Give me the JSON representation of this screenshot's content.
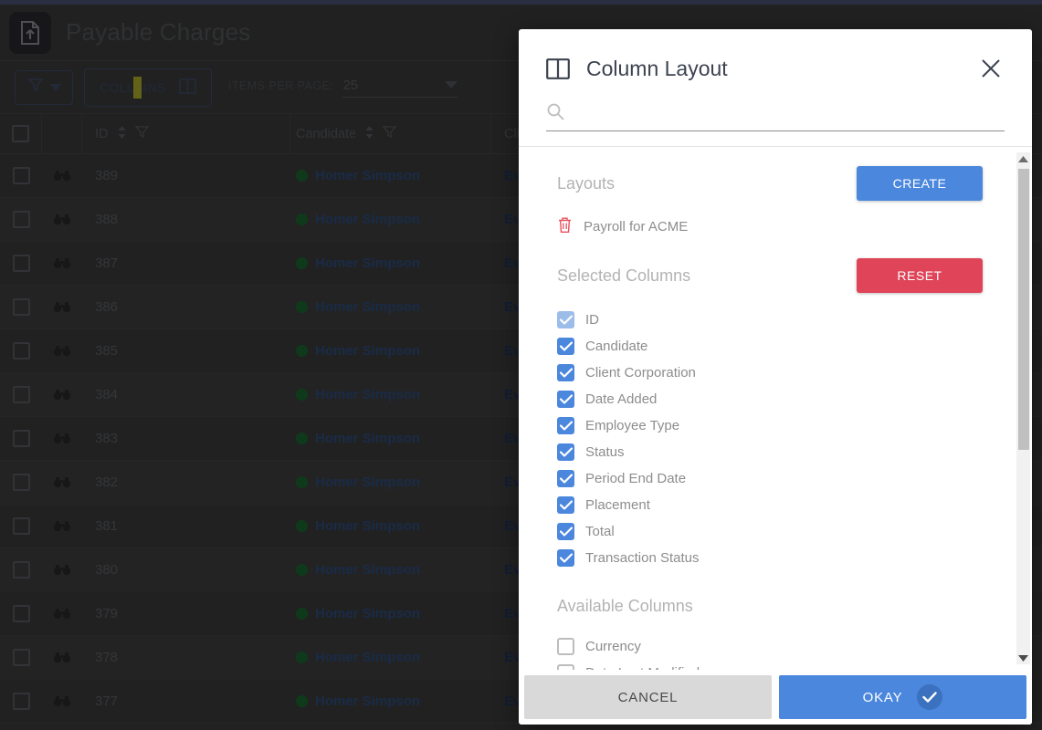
{
  "app": {
    "title": "Payable Charges",
    "logo_icon": "document-upload-icon",
    "toolbar": {
      "filter_icon": "filter-icon",
      "filter_caret_icon": "chevron-down-icon",
      "columns_label": "COLUMNS",
      "columns_icon": "column-layout-icon",
      "items_per_page_label": "ITEMS PER PAGE:",
      "items_per_page_value": "25",
      "items_per_page_arrow_icon": "chevron-down-icon"
    },
    "table": {
      "columns": [
        {
          "label": "",
          "name": "select-all"
        },
        {
          "label": "",
          "name": "preview"
        },
        {
          "label": "ID",
          "name": "id",
          "sort_icon": "sort-icon",
          "filter_icon": "filter-icon"
        },
        {
          "label": "Candidate",
          "name": "candidate",
          "sort_icon": "sort-icon",
          "filter_icon": "filter-icon"
        },
        {
          "label": "Cli",
          "name": "client-corporation"
        }
      ],
      "rows": [
        {
          "id": "389",
          "candidate": "Homer Simpson",
          "client": "Ev"
        },
        {
          "id": "388",
          "candidate": "Homer Simpson",
          "client": "Ev"
        },
        {
          "id": "387",
          "candidate": "Homer Simpson",
          "client": "Ev"
        },
        {
          "id": "386",
          "candidate": "Homer Simpson",
          "client": "Ev"
        },
        {
          "id": "385",
          "candidate": "Homer Simpson",
          "client": "Ev"
        },
        {
          "id": "384",
          "candidate": "Homer Simpson",
          "client": "Ev"
        },
        {
          "id": "383",
          "candidate": "Homer Simpson",
          "client": "Ev"
        },
        {
          "id": "382",
          "candidate": "Homer Simpson",
          "client": "Ev"
        },
        {
          "id": "381",
          "candidate": "Homer Simpson",
          "client": "Ev"
        },
        {
          "id": "380",
          "candidate": "Homer Simpson",
          "client": "Ev"
        },
        {
          "id": "379",
          "candidate": "Homer Simpson",
          "client": "Ev"
        },
        {
          "id": "378",
          "candidate": "Homer Simpson",
          "client": "Ev"
        },
        {
          "id": "377",
          "candidate": "Homer Simpson",
          "client": "Ev"
        }
      ]
    }
  },
  "modal": {
    "icon": "column-layout-icon",
    "title": "Column Layout",
    "close_icon": "close-icon",
    "search": {
      "icon": "search-icon",
      "value": "",
      "placeholder": ""
    },
    "layouts": {
      "title": "Layouts",
      "create_label": "CREATE",
      "items": [
        {
          "label": "Payroll for ACME",
          "delete_icon": "trash-icon"
        }
      ]
    },
    "selected_columns": {
      "title": "Selected Columns",
      "reset_label": "RESET",
      "items": [
        {
          "label": "ID",
          "checked": true,
          "dim": true
        },
        {
          "label": "Candidate",
          "checked": true
        },
        {
          "label": "Client Corporation",
          "checked": true
        },
        {
          "label": "Date Added",
          "checked": true
        },
        {
          "label": "Employee Type",
          "checked": true
        },
        {
          "label": "Status",
          "checked": true
        },
        {
          "label": "Period End Date",
          "checked": true
        },
        {
          "label": "Placement",
          "checked": true
        },
        {
          "label": "Total",
          "checked": true
        },
        {
          "label": "Transaction Status",
          "checked": true
        }
      ]
    },
    "available_columns": {
      "title": "Available Columns",
      "items": [
        {
          "label": "Currency",
          "checked": false
        },
        {
          "label": "Date Last Modified",
          "checked": false
        }
      ]
    },
    "scrollbar": {
      "up_icon": "caret-up-icon",
      "down_icon": "caret-down-icon"
    },
    "footer": {
      "cancel_label": "CANCEL",
      "okay_label": "OKAY",
      "okay_icon": "check-circle-icon"
    }
  },
  "colors": {
    "primary": "#4a87dd",
    "danger": "#df4458",
    "app_bg": "#3d3d3d",
    "top_strip": "#4c5775",
    "status_dot": "#1b6b32",
    "highlight": "#c8c82a"
  }
}
